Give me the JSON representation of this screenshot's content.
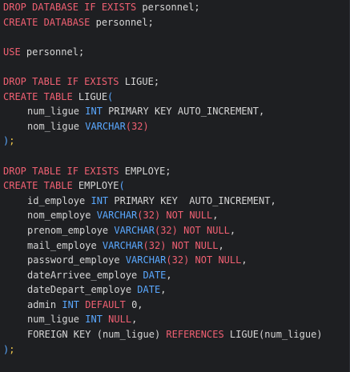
{
  "theme": {
    "background": "#1e1f22",
    "text": "#d6d6d6",
    "keyword": "#f06072",
    "type": "#5aa8ff",
    "punctuation": "#f2c94c"
  },
  "code": {
    "lines": [
      {
        "segments": [
          {
            "t": "DROP DATABASE IF EXISTS ",
            "c": "kw"
          },
          {
            "t": "personnel",
            "c": "ident"
          },
          {
            "t": ";",
            "c": "ident"
          }
        ]
      },
      {
        "segments": [
          {
            "t": "CREATE DATABASE ",
            "c": "kw"
          },
          {
            "t": "personnel",
            "c": "ident"
          },
          {
            "t": ";",
            "c": "ident"
          }
        ]
      },
      {
        "segments": []
      },
      {
        "segments": [
          {
            "t": "USE ",
            "c": "kw"
          },
          {
            "t": "personnel",
            "c": "ident"
          },
          {
            "t": ";",
            "c": "ident"
          }
        ]
      },
      {
        "segments": []
      },
      {
        "segments": [
          {
            "t": "DROP TABLE IF EXISTS ",
            "c": "kw"
          },
          {
            "t": "LIGUE",
            "c": "ident"
          },
          {
            "t": ";",
            "c": "ident"
          }
        ]
      },
      {
        "segments": [
          {
            "t": "CREATE TABLE ",
            "c": "kw"
          },
          {
            "t": "LIGUE",
            "c": "ident"
          },
          {
            "t": "(",
            "c": "type"
          }
        ]
      },
      {
        "indent": true,
        "segments": [
          {
            "t": "num_ligue ",
            "c": "ident"
          },
          {
            "t": "INT ",
            "c": "type"
          },
          {
            "t": "PRIMARY KEY AUTO_INCREMENT",
            "c": "ident"
          },
          {
            "t": ",",
            "c": "ident"
          }
        ]
      },
      {
        "indent": true,
        "segments": [
          {
            "t": "nom_ligue ",
            "c": "ident"
          },
          {
            "t": "VARCHAR",
            "c": "type"
          },
          {
            "t": "(",
            "c": "kw"
          },
          {
            "t": "32",
            "c": "kw"
          },
          {
            "t": ")",
            "c": "kw"
          }
        ]
      },
      {
        "segments": [
          {
            "t": ")",
            "c": "type"
          },
          {
            "t": ";",
            "c": "punct"
          }
        ]
      },
      {
        "segments": []
      },
      {
        "segments": [
          {
            "t": "DROP TABLE IF EXISTS ",
            "c": "kw"
          },
          {
            "t": "EMPLOYE",
            "c": "ident"
          },
          {
            "t": ";",
            "c": "ident"
          }
        ]
      },
      {
        "segments": [
          {
            "t": "CREATE TABLE ",
            "c": "kw"
          },
          {
            "t": "EMPLOYE",
            "c": "ident"
          },
          {
            "t": "(",
            "c": "type"
          }
        ]
      },
      {
        "indent": true,
        "segments": [
          {
            "t": "id_employe ",
            "c": "ident"
          },
          {
            "t": "INT ",
            "c": "type"
          },
          {
            "t": "PRIMARY KEY  AUTO_INCREMENT",
            "c": "ident"
          },
          {
            "t": ",",
            "c": "ident"
          }
        ]
      },
      {
        "indent": true,
        "segments": [
          {
            "t": "nom_employe ",
            "c": "ident"
          },
          {
            "t": "VARCHAR",
            "c": "type"
          },
          {
            "t": "(",
            "c": "kw"
          },
          {
            "t": "32",
            "c": "kw"
          },
          {
            "t": ")",
            "c": "kw"
          },
          {
            "t": " NOT NULL",
            "c": "kw"
          },
          {
            "t": ",",
            "c": "ident"
          }
        ]
      },
      {
        "indent": true,
        "segments": [
          {
            "t": "prenom_employe ",
            "c": "ident"
          },
          {
            "t": "VARCHAR",
            "c": "type"
          },
          {
            "t": "(",
            "c": "kw"
          },
          {
            "t": "32",
            "c": "kw"
          },
          {
            "t": ")",
            "c": "kw"
          },
          {
            "t": " NOT NULL",
            "c": "kw"
          },
          {
            "t": ",",
            "c": "ident"
          }
        ]
      },
      {
        "indent": true,
        "segments": [
          {
            "t": "mail_employe ",
            "c": "ident"
          },
          {
            "t": "VARCHAR",
            "c": "type"
          },
          {
            "t": "(",
            "c": "kw"
          },
          {
            "t": "32",
            "c": "kw"
          },
          {
            "t": ")",
            "c": "kw"
          },
          {
            "t": " NOT NULL",
            "c": "kw"
          },
          {
            "t": ",",
            "c": "ident"
          }
        ]
      },
      {
        "indent": true,
        "segments": [
          {
            "t": "password_employe ",
            "c": "ident"
          },
          {
            "t": "VARCHAR",
            "c": "type"
          },
          {
            "t": "(",
            "c": "kw"
          },
          {
            "t": "32",
            "c": "kw"
          },
          {
            "t": ")",
            "c": "kw"
          },
          {
            "t": " NOT NULL",
            "c": "kw"
          },
          {
            "t": ",",
            "c": "ident"
          }
        ]
      },
      {
        "indent": true,
        "segments": [
          {
            "t": "dateArrivee_employe ",
            "c": "ident"
          },
          {
            "t": "DATE",
            "c": "type"
          },
          {
            "t": ",",
            "c": "ident"
          }
        ]
      },
      {
        "indent": true,
        "segments": [
          {
            "t": "dateDepart_employe ",
            "c": "ident"
          },
          {
            "t": "DATE",
            "c": "type"
          },
          {
            "t": ",",
            "c": "ident"
          }
        ]
      },
      {
        "indent": true,
        "segments": [
          {
            "t": "admin ",
            "c": "ident"
          },
          {
            "t": "INT ",
            "c": "type"
          },
          {
            "t": "DEFAULT ",
            "c": "kw"
          },
          {
            "t": "0",
            "c": "num"
          },
          {
            "t": ",",
            "c": "ident"
          }
        ]
      },
      {
        "indent": true,
        "segments": [
          {
            "t": "num_ligue ",
            "c": "ident"
          },
          {
            "t": "INT ",
            "c": "type"
          },
          {
            "t": "NULL",
            "c": "kw"
          },
          {
            "t": ",",
            "c": "ident"
          }
        ]
      },
      {
        "indent": true,
        "segments": [
          {
            "t": "FOREIGN KEY ",
            "c": "ident"
          },
          {
            "t": "(",
            "c": "paren"
          },
          {
            "t": "num_ligue",
            "c": "ident"
          },
          {
            "t": ") ",
            "c": "paren"
          },
          {
            "t": "REFERENCES ",
            "c": "kw"
          },
          {
            "t": "LIGUE",
            "c": "ident"
          },
          {
            "t": "(",
            "c": "paren"
          },
          {
            "t": "num_ligue",
            "c": "ident"
          },
          {
            "t": ")",
            "c": "paren"
          }
        ]
      },
      {
        "segments": [
          {
            "t": ")",
            "c": "type"
          },
          {
            "t": ";",
            "c": "punct"
          }
        ]
      }
    ]
  }
}
